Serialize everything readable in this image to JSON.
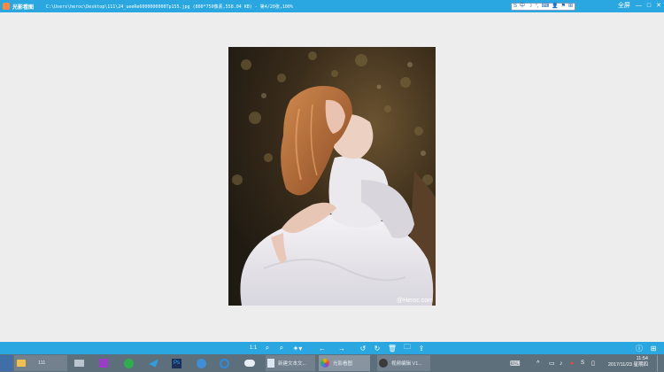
{
  "titlebar": {
    "app_name": "光影看图",
    "file_info": "C:\\Users\\heroc\\Desktop\\111\\24_ueeRe6000000000Tp155.jpg  (800*750像素,558.04 KB)  - 第4/20张,100%",
    "ime_label": "中",
    "window_controls": [
      "全屏",
      "—",
      "□",
      "✕"
    ]
  },
  "image": {
    "watermark": "@Heroc.com",
    "colors": {
      "bg_dark": "#2e2517",
      "hair": "#b0653a",
      "dress": "#efeef2",
      "skin": "#e9c8b9"
    }
  },
  "toolbar": {
    "actual_size_label": "1:1"
  },
  "taskbar": {
    "folder_label": "111",
    "items": [
      "新建文本文...",
      "光影看图",
      "视频编辑 V1..."
    ],
    "time": "11:54",
    "date": "2017/11/23 星期四"
  },
  "colors": {
    "accent": "#2aa7e0",
    "taskbar": "#5e6f7c",
    "viewer_bg": "#ededed"
  }
}
